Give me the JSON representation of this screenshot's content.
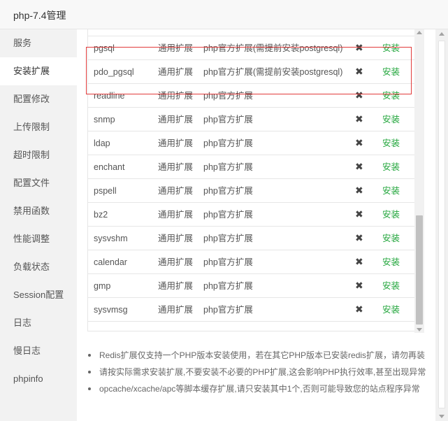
{
  "window": {
    "title": "php-7.4管理"
  },
  "sidebar": {
    "items": [
      {
        "label": "服务"
      },
      {
        "label": "安装扩展",
        "active": true
      },
      {
        "label": "配置修改"
      },
      {
        "label": "上传限制"
      },
      {
        "label": "超时限制"
      },
      {
        "label": "配置文件"
      },
      {
        "label": "禁用函数"
      },
      {
        "label": "性能调整"
      },
      {
        "label": "负载状态"
      },
      {
        "label": "Session配置"
      },
      {
        "label": "日志"
      },
      {
        "label": "慢日志"
      },
      {
        "label": "phpinfo"
      }
    ]
  },
  "extensions": {
    "delete_icon": "✖",
    "rows": [
      {
        "name": "",
        "type": "",
        "desc": "",
        "action": "",
        "partial": true
      },
      {
        "name": "pgsql",
        "type": "通用扩展",
        "desc": "php官方扩展(需提前安装postgresql)",
        "action": "安装",
        "highlighted": true
      },
      {
        "name": "pdo_pgsql",
        "type": "通用扩展",
        "desc": "php官方扩展(需提前安装postgresql)",
        "action": "安装",
        "highlighted": true
      },
      {
        "name": "readline",
        "type": "通用扩展",
        "desc": "php官方扩展",
        "action": "安装"
      },
      {
        "name": "snmp",
        "type": "通用扩展",
        "desc": "php官方扩展",
        "action": "安装"
      },
      {
        "name": "ldap",
        "type": "通用扩展",
        "desc": "php官方扩展",
        "action": "安装"
      },
      {
        "name": "enchant",
        "type": "通用扩展",
        "desc": "php官方扩展",
        "action": "安装"
      },
      {
        "name": "pspell",
        "type": "通用扩展",
        "desc": "php官方扩展",
        "action": "安装"
      },
      {
        "name": "bz2",
        "type": "通用扩展",
        "desc": "php官方扩展",
        "action": "安装"
      },
      {
        "name": "sysvshm",
        "type": "通用扩展",
        "desc": "php官方扩展",
        "action": "安装"
      },
      {
        "name": "calendar",
        "type": "通用扩展",
        "desc": "php官方扩展",
        "action": "安装"
      },
      {
        "name": "gmp",
        "type": "通用扩展",
        "desc": "php官方扩展",
        "action": "安装"
      },
      {
        "name": "sysvmsg",
        "type": "通用扩展",
        "desc": "php官方扩展",
        "action": "安装"
      }
    ]
  },
  "notes": [
    "Redis扩展仅支持一个PHP版本安装使用，若在其它PHP版本已安装redis扩展，请勿再装",
    "请按实际需求安装扩展,不要安装不必要的PHP扩展,这会影响PHP执行效率,甚至出现异常",
    "opcache/xcache/apc等脚本缓存扩展,请只安装其中1个,否则可能导致您的站点程序异常"
  ],
  "colors": {
    "install_green": "#20a53a",
    "highlight_red": "#e23b3b"
  }
}
